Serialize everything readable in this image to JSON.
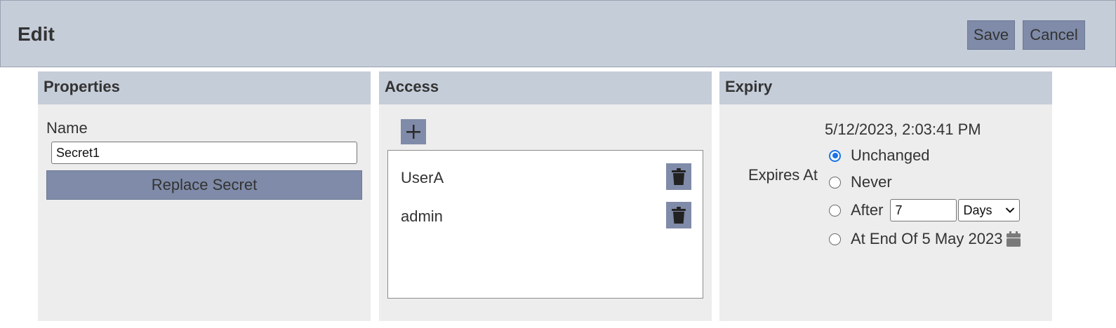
{
  "header": {
    "title": "Edit",
    "save_label": "Save",
    "cancel_label": "Cancel"
  },
  "properties": {
    "heading": "Properties",
    "name_label": "Name",
    "name_value": "Secret1",
    "replace_label": "Replace Secret"
  },
  "access": {
    "heading": "Access",
    "add_icon": "plus-icon",
    "entries": [
      {
        "name": "UserA",
        "icon": "trash-icon"
      },
      {
        "name": "admin",
        "icon": "trash-icon"
      }
    ]
  },
  "expiry": {
    "heading": "Expiry",
    "current": "5/12/2023, 2:03:41 PM",
    "label": "Expires At",
    "options": {
      "unchanged": "Unchanged",
      "never": "Never",
      "after": "After",
      "at_end_of": "At End Of 5 May 2023"
    },
    "selected": "unchanged",
    "after_value": "7",
    "after_unit": "Days",
    "calendar_icon": "calendar-icon"
  },
  "colors": {
    "header_bg": "#c5cdd9",
    "button_bg": "#7f8ba8",
    "panel_bg": "#ededed",
    "radio_accent": "#1a73e8"
  }
}
